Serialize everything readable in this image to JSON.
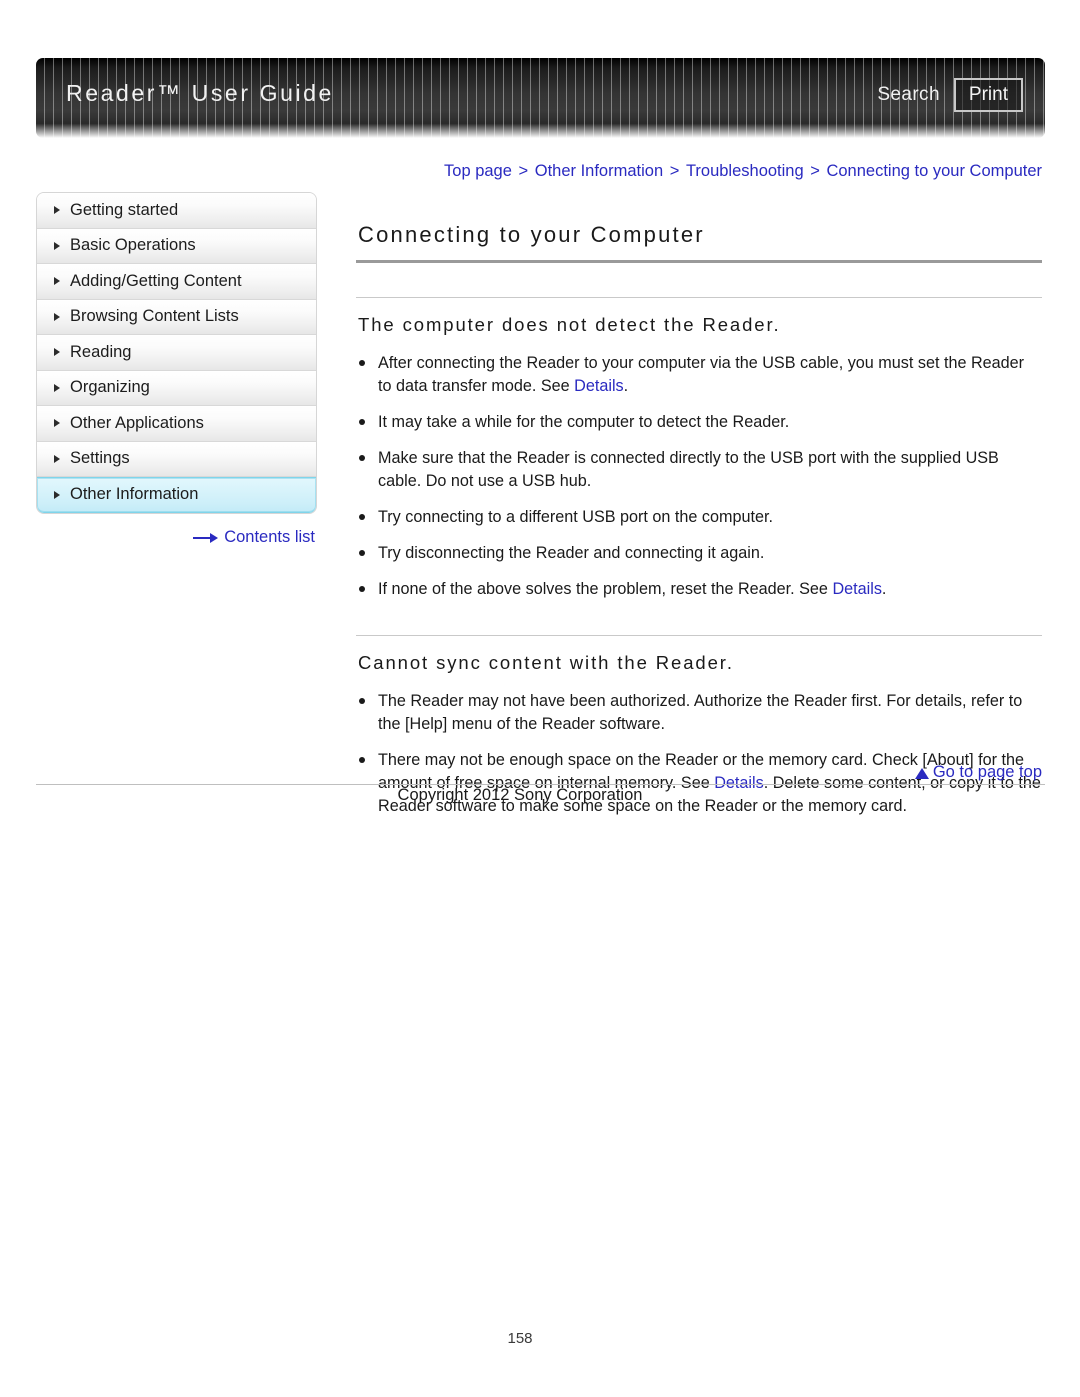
{
  "header": {
    "brand_title": "Reader™ User Guide",
    "search_label": "Search",
    "print_label": "Print"
  },
  "breadcrumb": {
    "items": [
      "Top page",
      "Other Information",
      "Troubleshooting",
      "Connecting to your Computer"
    ],
    "separator": ">"
  },
  "sidebar": {
    "items": [
      {
        "label": "Getting started",
        "active": false
      },
      {
        "label": "Basic Operations",
        "active": false
      },
      {
        "label": "Adding/Getting Content",
        "active": false
      },
      {
        "label": "Browsing Content Lists",
        "active": false
      },
      {
        "label": "Reading",
        "active": false
      },
      {
        "label": "Organizing",
        "active": false
      },
      {
        "label": "Other Applications",
        "active": false
      },
      {
        "label": "Settings",
        "active": false
      },
      {
        "label": "Other Information",
        "active": true
      }
    ],
    "contents_list_label": "Contents list"
  },
  "main": {
    "page_title": "Connecting to your Computer",
    "sections": [
      {
        "heading": "The computer does not detect the Reader.",
        "bullets": [
          [
            {
              "t": "text",
              "v": "After connecting the Reader to your computer via the USB cable, you must set the Reader to data transfer mode. See "
            },
            {
              "t": "link",
              "v": "Details"
            },
            {
              "t": "text",
              "v": "."
            }
          ],
          [
            {
              "t": "text",
              "v": "It may take a while for the computer to detect the Reader."
            }
          ],
          [
            {
              "t": "text",
              "v": "Make sure that the Reader is connected directly to the USB port with the supplied USB cable. Do not use a USB hub."
            }
          ],
          [
            {
              "t": "text",
              "v": "Try connecting to a different USB port on the computer."
            }
          ],
          [
            {
              "t": "text",
              "v": "Try disconnecting the Reader and connecting it again."
            }
          ],
          [
            {
              "t": "text",
              "v": "If none of the above solves the problem, reset the Reader. See "
            },
            {
              "t": "link",
              "v": "Details"
            },
            {
              "t": "text",
              "v": "."
            }
          ]
        ]
      },
      {
        "heading": "Cannot sync content with the Reader.",
        "bullets": [
          [
            {
              "t": "text",
              "v": "The Reader may not have been authorized. Authorize the Reader first. For details, refer to the [Help] menu of the Reader software."
            }
          ],
          [
            {
              "t": "text",
              "v": "There may not be enough space on the Reader or the memory card. Check [About] for the amount of free space on internal memory. See "
            },
            {
              "t": "link",
              "v": "Details"
            },
            {
              "t": "text",
              "v": ". Delete some content, or copy it to the Reader software to make some space on the Reader or the memory card."
            }
          ]
        ]
      }
    ]
  },
  "footer": {
    "go_to_page_top_label": "Go to page top",
    "copyright": "Copyright 2012 Sony Corporation",
    "page_number": "158"
  }
}
